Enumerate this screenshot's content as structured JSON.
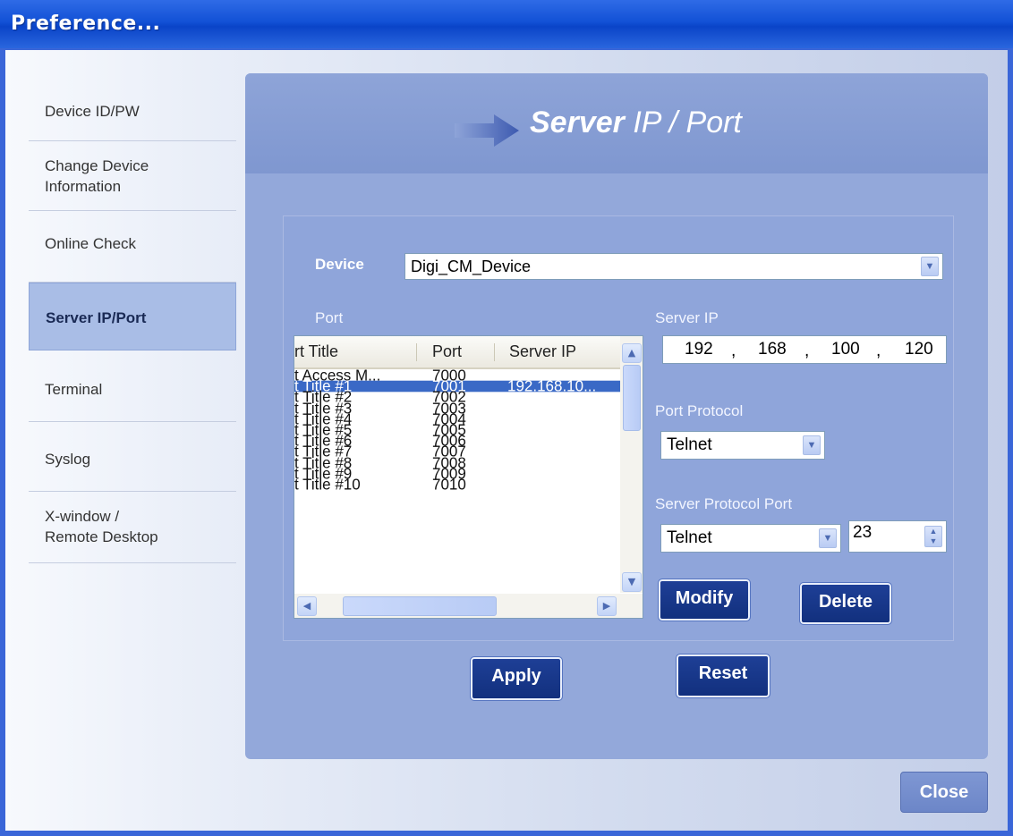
{
  "window": {
    "title": "Preference..."
  },
  "sidebar": {
    "items": [
      {
        "label_lines": [
          "Device ID/PW"
        ],
        "active": false
      },
      {
        "label_lines": [
          "Change Device",
          "Information"
        ],
        "active": false
      },
      {
        "label_lines": [
          "Online Check"
        ],
        "active": false
      },
      {
        "label_lines": [
          "Server IP/Port"
        ],
        "active": true
      },
      {
        "label_lines": [
          "Terminal"
        ],
        "active": false
      },
      {
        "label_lines": [
          "Syslog"
        ],
        "active": false
      },
      {
        "label_lines": [
          "X-window /",
          "Remote Desktop"
        ],
        "active": false
      }
    ]
  },
  "header": {
    "title_bold": "Server",
    "title_rest": " IP / Port"
  },
  "form": {
    "device_label": "Device",
    "device_value": "Digi_CM_Device",
    "port_label": "Port",
    "server_ip_label": "Server IP",
    "server_ip": [
      "192",
      "168",
      "100",
      "120"
    ],
    "port_protocol_label": "Port Protocol",
    "port_protocol_value": "Telnet",
    "server_protocol_port_label": "Server Protocol Port",
    "server_protocol_value": "Telnet",
    "server_port_number": "23"
  },
  "port_table": {
    "columns": [
      "rt Title",
      "Port",
      "Server IP"
    ],
    "rows": [
      {
        "title": "t Access M...",
        "port": "7000",
        "server_ip": ""
      },
      {
        "title": "t Title #1",
        "port": "7001",
        "server_ip": "192.168.10...",
        "selected": true
      },
      {
        "title": "t Title #2",
        "port": "7002",
        "server_ip": ""
      },
      {
        "title": "t Title #3",
        "port": "7003",
        "server_ip": ""
      },
      {
        "title": "t Title #4",
        "port": "7004",
        "server_ip": ""
      },
      {
        "title": "t Title #5",
        "port": "7005",
        "server_ip": ""
      },
      {
        "title": "t Title #6",
        "port": "7006",
        "server_ip": ""
      },
      {
        "title": "t Title #7",
        "port": "7007",
        "server_ip": ""
      },
      {
        "title": "t Title #8",
        "port": "7008",
        "server_ip": ""
      },
      {
        "title": "t Title #9",
        "port": "7009",
        "server_ip": ""
      },
      {
        "title": "t Title #10",
        "port": "7010",
        "server_ip": ""
      }
    ]
  },
  "buttons": {
    "modify": "Modify",
    "delete": "Delete",
    "apply": "Apply",
    "reset": "Reset",
    "close": "Close"
  },
  "icons": {
    "dropdown": "chevron-down-icon",
    "spinner": "spinner-arrows-icon",
    "header_arrow": "arrow-right-icon"
  },
  "colors": {
    "titlebar": "#0a44c8",
    "selection": "#3a69c6",
    "button_navy": "#12307e"
  }
}
